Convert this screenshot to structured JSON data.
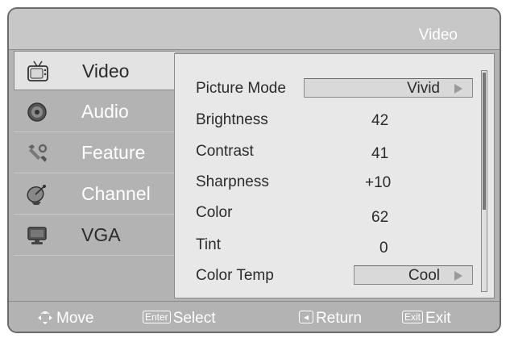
{
  "header": {
    "title": "Video"
  },
  "sidebar": {
    "items": [
      {
        "label": "Video",
        "icon": "tv-icon"
      },
      {
        "label": "Audio",
        "icon": "speaker-icon"
      },
      {
        "label": "Feature",
        "icon": "wrench-icon"
      },
      {
        "label": "Channel",
        "icon": "satellite-dish-icon"
      },
      {
        "label": "VGA",
        "icon": "monitor-icon"
      }
    ]
  },
  "settings": {
    "picture_mode": {
      "label": "Picture Mode",
      "value": "Vivid"
    },
    "brightness": {
      "label": "Brightness",
      "value": "42"
    },
    "contrast": {
      "label": "Contrast",
      "value": "41"
    },
    "sharpness": {
      "label": "Sharpness",
      "value": "+10"
    },
    "color": {
      "label": "Color",
      "value": "62"
    },
    "tint": {
      "label": "Tint",
      "value": "0"
    },
    "color_temp": {
      "label": "Color Temp",
      "value": "Cool"
    }
  },
  "footer": {
    "move": "Move",
    "enter_key": "Enter",
    "select": "Select",
    "return": "Return",
    "exit_key": "Exit",
    "exit": "Exit"
  },
  "colors": {
    "frame": "#b3b3b3",
    "panel": "#e8e8e8",
    "text_dark": "#2b2b2b",
    "text_light": "#ffffff"
  }
}
